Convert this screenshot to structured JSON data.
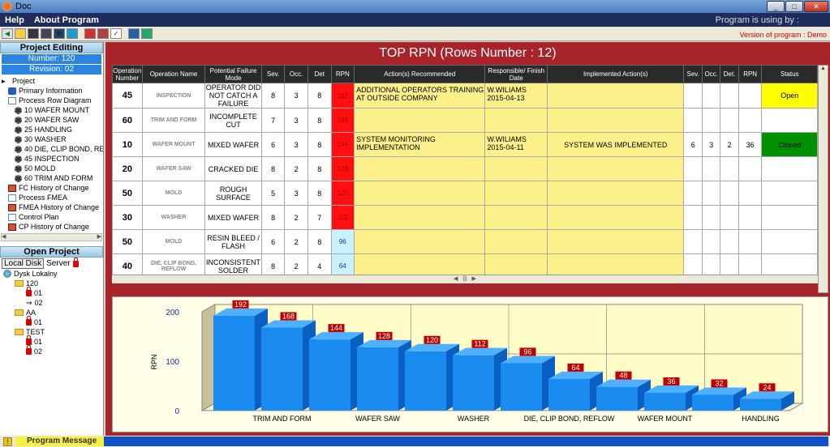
{
  "window": {
    "title": "Doc",
    "buttons": [
      "_",
      "□",
      "✕"
    ]
  },
  "menu": {
    "items": [
      "Help",
      "About Program"
    ],
    "program_using": "Program is using by :"
  },
  "toolbar": {
    "icons": [
      "exit-icon",
      "folder-icon",
      "save-icon",
      "save-as-icon",
      "settings-icon",
      "globe-icon",
      "report-icon",
      "report-alt-icon",
      "checkbox-icon",
      "window-icon",
      "window-alt-icon"
    ]
  },
  "version_text": "Version of program : Demo",
  "left": {
    "project_editing": "Project Editing",
    "number": "Number: 120",
    "revision": "Revision: 02",
    "tree": [
      {
        "label": "Project",
        "icon": "arrow-icon",
        "level": 0
      },
      {
        "label": "Primary Information",
        "icon": "info-icon",
        "level": 1
      },
      {
        "label": "Process Row Diagram",
        "icon": "diagram-icon",
        "level": 1
      },
      {
        "label": "10 WAFER MOUNT",
        "icon": "gear-icon",
        "level": 2
      },
      {
        "label": "20 WAFER SAW",
        "icon": "gear-icon",
        "level": 2
      },
      {
        "label": "25 HANDLING",
        "icon": "gear-icon",
        "level": 2
      },
      {
        "label": "30 WASHER",
        "icon": "gear-icon",
        "level": 2
      },
      {
        "label": "40 DIE, CLIP BOND, RE",
        "icon": "gear-icon",
        "level": 2
      },
      {
        "label": "45 INSPECTION",
        "icon": "gear-icon",
        "level": 2
      },
      {
        "label": "50 MOLD",
        "icon": "gear-icon",
        "level": 2
      },
      {
        "label": "60 TRIM AND FORM",
        "icon": "gear-icon",
        "level": 2
      },
      {
        "label": "FC History of Change",
        "icon": "book-icon",
        "level": 1
      },
      {
        "label": "Process FMEA",
        "icon": "doc-icon",
        "level": 1
      },
      {
        "label": "FMEA History of Change",
        "icon": "book-icon",
        "level": 1
      },
      {
        "label": "Control Plan",
        "icon": "doc-icon",
        "level": 1
      },
      {
        "label": "CP History of Change",
        "icon": "book-icon",
        "level": 1
      }
    ],
    "open_project": "Open Project",
    "local_disk": "Local Disk",
    "server": "Server",
    "tree2": [
      {
        "label": "Dysk Lokalny",
        "icon": "globe-icon",
        "level": 0
      },
      {
        "label": "120",
        "icon": "folder-icon",
        "level": 1
      },
      {
        "label": "01",
        "icon": "lock-icon",
        "level": 2
      },
      {
        "label": "02",
        "icon": "arrow-icon",
        "level": 2
      },
      {
        "label": "AA",
        "icon": "folder-icon",
        "level": 1
      },
      {
        "label": "01",
        "icon": "lock-icon",
        "level": 2
      },
      {
        "label": "TEST",
        "icon": "folder-icon",
        "level": 1
      },
      {
        "label": "01",
        "icon": "lock-icon",
        "level": 2
      },
      {
        "label": "02",
        "icon": "lock-icon",
        "level": 2
      }
    ]
  },
  "main": {
    "title": "TOP RPN (Rows Number : 12)",
    "columns": [
      "Operation Number",
      "Operation Name",
      "Potential Failure Mode",
      "Sev.",
      "Occ.",
      "Det",
      "RPN",
      "Action(s) Recommended",
      "Responsible/ Finish Date",
      "Implemented Action(s)",
      "Sev.",
      "Occ.",
      "Det.",
      "RPN",
      "Status"
    ],
    "rows": [
      {
        "num": "45",
        "name": "INSPECTION",
        "mode": "OPERATOR DID NOT CATCH A FAILURE",
        "sev": "8",
        "occ": "3",
        "det": "8",
        "rpn": "192",
        "action": "ADDITIONAL OPERATORS TRAINING AT OUTSIDE COMPANY",
        "resp": "W.WILIAMS 2015-04-13",
        "impl": "",
        "sev2": "",
        "occ2": "",
        "det2": "",
        "rpn2": "",
        "status": "Open"
      },
      {
        "num": "60",
        "name": "TRIM AND FORM",
        "mode": "INCOMPLETE CUT",
        "sev": "7",
        "occ": "3",
        "det": "8",
        "rpn": "168",
        "action": "",
        "resp": "",
        "impl": "",
        "sev2": "",
        "occ2": "",
        "det2": "",
        "rpn2": "",
        "status": ""
      },
      {
        "num": "10",
        "name": "WAFER MOUNT",
        "mode": "MIXED WAFER",
        "sev": "6",
        "occ": "3",
        "det": "8",
        "rpn": "144",
        "action": "SYSTEM MONITORING IMPLEMENTATION",
        "resp": "W.WILIAMS 2015-04-11",
        "impl": "SYSTEM WAS IMPLEMENTED",
        "sev2": "6",
        "occ2": "3",
        "det2": "2",
        "rpn2": "36",
        "status": "Closed"
      },
      {
        "num": "20",
        "name": "WAFER SAW",
        "mode": "CRACKED DIE",
        "sev": "8",
        "occ": "2",
        "det": "8",
        "rpn": "128",
        "action": "",
        "resp": "",
        "impl": "",
        "sev2": "",
        "occ2": "",
        "det2": "",
        "rpn2": "",
        "status": ""
      },
      {
        "num": "50",
        "name": "MOLD",
        "mode": "ROUGH SURFACE",
        "sev": "5",
        "occ": "3",
        "det": "8",
        "rpn": "120",
        "action": "",
        "resp": "",
        "impl": "",
        "sev2": "",
        "occ2": "",
        "det2": "",
        "rpn2": "",
        "status": ""
      },
      {
        "num": "30",
        "name": "WASHER",
        "mode": "MIXED WAFER",
        "sev": "8",
        "occ": "2",
        "det": "7",
        "rpn": "112",
        "action": "",
        "resp": "",
        "impl": "",
        "sev2": "",
        "occ2": "",
        "det2": "",
        "rpn2": "",
        "status": ""
      },
      {
        "num": "50",
        "name": "MOLD",
        "mode": "RESIN BLEED / FLASH",
        "sev": "6",
        "occ": "2",
        "det": "8",
        "rpn": "96",
        "action": "",
        "resp": "",
        "impl": "",
        "sev2": "",
        "occ2": "",
        "det2": "",
        "rpn2": "",
        "status": ""
      },
      {
        "num": "40",
        "name": "DIE, CLIP BOND, REFLOW",
        "mode": "INCONSISTENT SOLDER",
        "sev": "8",
        "occ": "2",
        "det": "4",
        "rpn": "64",
        "action": "",
        "resp": "",
        "impl": "",
        "sev2": "",
        "occ2": "",
        "det2": "",
        "rpn2": "",
        "status": ""
      }
    ]
  },
  "chart_data": {
    "type": "bar",
    "ylabel": "RPN",
    "ylim": [
      0,
      200
    ],
    "yticks": [
      0,
      100,
      200
    ],
    "values": [
      192,
      168,
      144,
      128,
      120,
      112,
      96,
      64,
      48,
      36,
      32,
      24
    ],
    "xlabels": [
      "TRIM AND FORM",
      "WAFER SAW",
      "WASHER",
      "DIE, CLIP BOND, REFLOW",
      "WAFER MOUNT",
      "HANDLING"
    ],
    "xlabel_positions": [
      1,
      3,
      5,
      7,
      9,
      11
    ],
    "grid": true,
    "bar_color": "#1a8cf0",
    "label_color": "#c00000"
  },
  "status": {
    "message_label": "Program Message"
  }
}
